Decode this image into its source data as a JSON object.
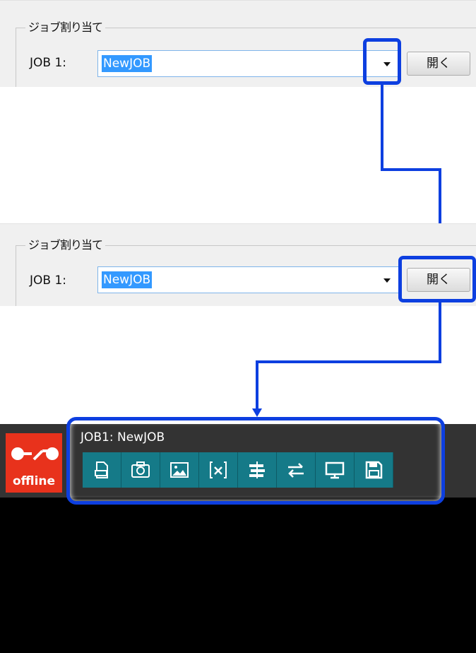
{
  "dialog": {
    "group_title": "ジョブ割り当て",
    "job_label": "JOB 1:",
    "job_value": "NewJOB",
    "open_button": "開く"
  },
  "app": {
    "status": "offline",
    "job_title": "JOB1: NewJOB",
    "toolbar_icons": [
      "job-file-icon",
      "camera-icon",
      "image-icon",
      "variable-icon",
      "settings-icon",
      "transfer-icon",
      "monitor-icon",
      "save-icon"
    ]
  },
  "colors": {
    "highlight": "#0d3fe0",
    "offline": "#e8321c",
    "toolbar": "#157a88"
  }
}
